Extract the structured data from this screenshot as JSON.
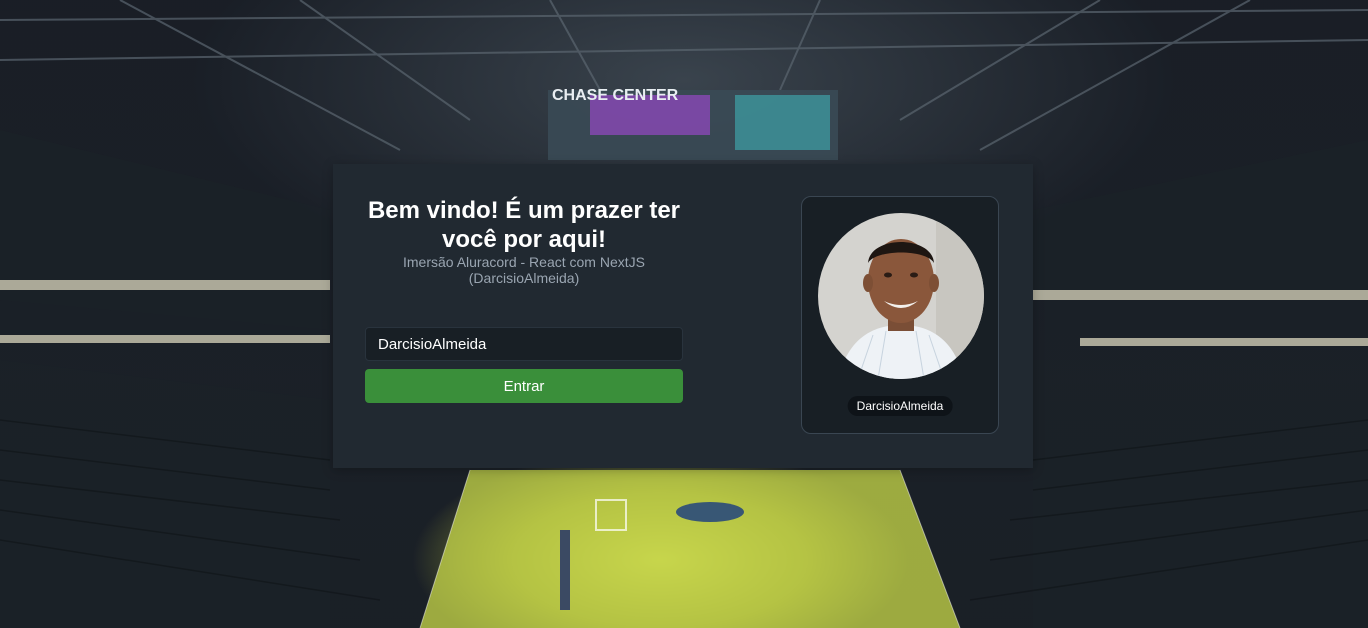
{
  "login": {
    "title": "Bem vindo! É um prazer ter você por aqui!",
    "subtitle": "Imersão Aluracord - React com NextJS (DarcisioAlmeida)",
    "username_value": "DarcisioAlmeida",
    "enter_label": "Entrar"
  },
  "profile": {
    "username": "DarcisioAlmeida"
  },
  "background": {
    "scene": "Chase Center arena",
    "scoreboard_text": "CHASE CENTER"
  },
  "colors": {
    "card": "#212931",
    "panel": "#181f25",
    "button": "#3a8f3a",
    "subtitle": "#9aa5b1"
  }
}
